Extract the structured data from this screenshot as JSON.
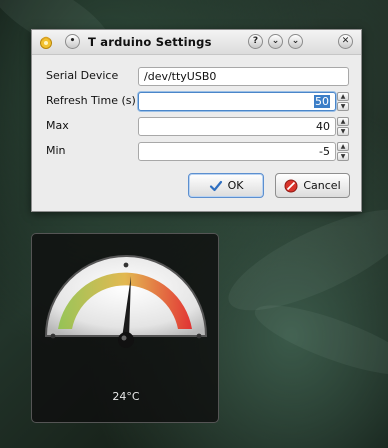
{
  "dialog": {
    "title": "T arduino Settings",
    "title_buttons": [
      "?",
      "⌄",
      "⌄",
      "✕"
    ],
    "fields": [
      {
        "label": "Serial Device",
        "value": "/dev/ttyUSB0"
      },
      {
        "label": "Refresh Time (s)",
        "value": "50"
      },
      {
        "label": "Max",
        "value": "40"
      },
      {
        "label": "Min",
        "value": "-5"
      }
    ],
    "ok_label": "OK",
    "cancel_label": "Cancel"
  },
  "widget": {
    "temperature": "24°C",
    "gauge_colors": {
      "low": "#8fc24a",
      "mid": "#e0b13e",
      "high": "#e32222"
    }
  },
  "icons": {
    "title_app": "arduino-icon",
    "ok": "checkmark-icon",
    "cancel": "cancel-icon"
  }
}
